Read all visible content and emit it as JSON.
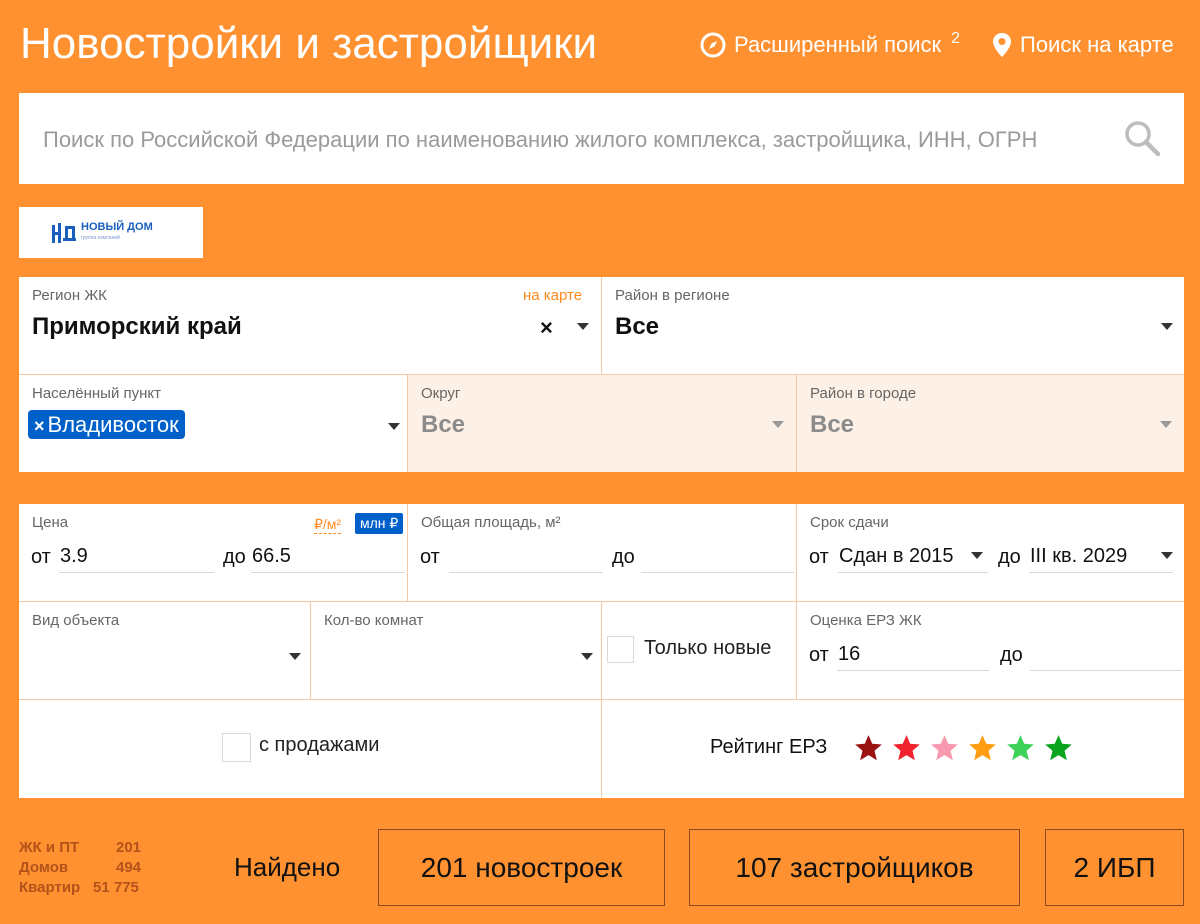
{
  "header": {
    "title": "Новостройки и застройщики",
    "advanced_search": "Расширенный поиск",
    "advanced_search_badge": "2",
    "map_search": "Поиск на карте"
  },
  "search": {
    "placeholder": "Поиск по Российской Федерации по наименованию жилого комплекса, застройщика, ИНН, ОГРН"
  },
  "logo": {
    "text": "НОВЫЙ ДОМ",
    "sub": "группа компаний"
  },
  "filters": {
    "region_label": "Регион ЖК",
    "region_map_link": "на карте",
    "region_value": "Приморский край",
    "district_label": "Район в регионе",
    "district_value": "Все",
    "locality_label": "Населённый пункт",
    "locality_tag": "Владивосток",
    "okrug_label": "Округ",
    "okrug_value": "Все",
    "city_district_label": "Район в городе",
    "city_district_value": "Все",
    "price_label": "Цена",
    "price_unit_m2": "₽/м²",
    "price_unit_mln": "млн ₽",
    "from": "от",
    "to": "до",
    "price_from": "3.9",
    "price_to": "66.5",
    "area_label": "Общая площадь, м²",
    "deadline_label": "Срок сдачи",
    "deadline_from": "Сдан в 2015",
    "deadline_to": "III кв. 2029",
    "object_type_label": "Вид объекта",
    "rooms_label": "Кол-во комнат",
    "only_new_label": "Только новые",
    "erz_score_label": "Оценка ЕРЗ ЖК",
    "erz_from": "16",
    "with_sales_label": "с продажами",
    "rating_label": "Рейтинг ЕРЗ"
  },
  "star_colors": [
    "#9b1212",
    "#f0232e",
    "#f79ab0",
    "#ff9c12",
    "#3fd15a",
    "#0aa31e"
  ],
  "stats": {
    "complexes_label": "ЖК и ПТ",
    "complexes_value": "201",
    "houses_label": "Домов",
    "houses_value": "494",
    "apartments_label": "Квартир",
    "apartments_value": "51 775"
  },
  "results": {
    "found_label": "Найдено",
    "buildings_button": "201 новостроек",
    "developers_button": "107 застройщиков",
    "ibp_button": "2 ИБП"
  }
}
